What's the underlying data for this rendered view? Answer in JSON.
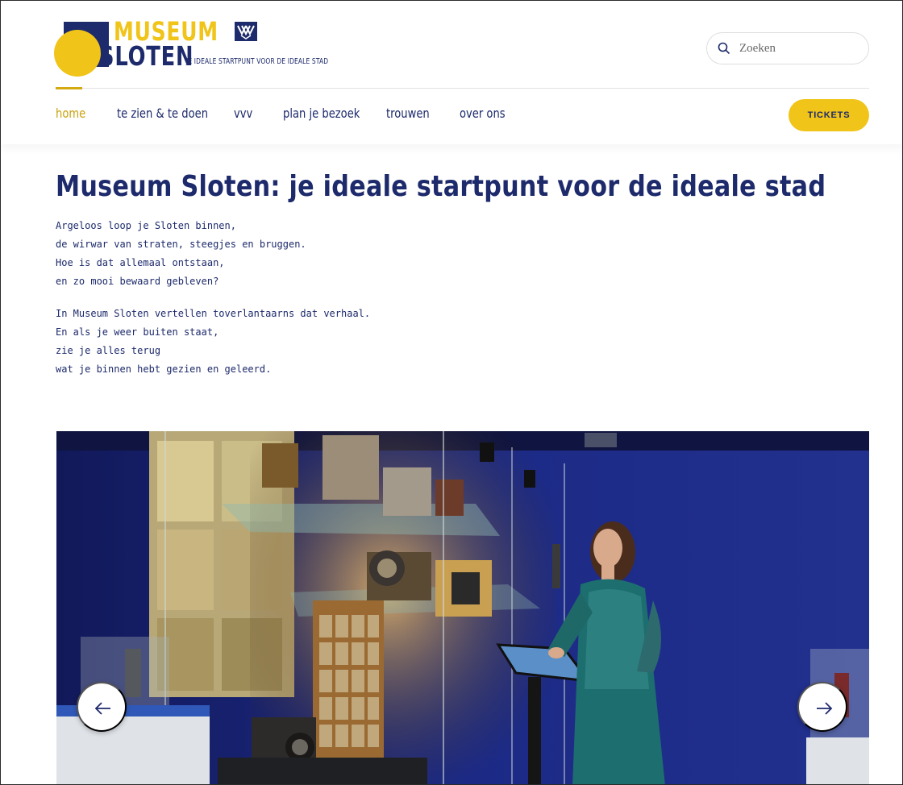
{
  "logo": {
    "word_top": "MUSEUM",
    "word_bottom": "SLOTEN",
    "tagline": "JE IDEALE STARTPUNT VOOR DE IDEALE STAD",
    "brand_colors": {
      "navy": "#1d2a6b",
      "yellow": "#f0c419"
    }
  },
  "search": {
    "placeholder": "Zoeken",
    "value": "",
    "icon": "search-icon"
  },
  "nav": {
    "items": [
      {
        "label": "home",
        "active": true
      },
      {
        "label": "te zien & te doen",
        "active": false
      },
      {
        "label": "vvv",
        "active": false
      },
      {
        "label": "plan je bezoek",
        "active": false
      },
      {
        "label": "trouwen",
        "active": false
      },
      {
        "label": "over ons",
        "active": false
      }
    ],
    "tickets_label": "TICKETS"
  },
  "main": {
    "title": "Museum Sloten: je ideale startpunt voor de ideale stad",
    "poem_stanza_1": "Argeloos loop je Sloten binnen,\nde wirwar van straten, steegjes en bruggen.\nHoe is dat allemaal ontstaan,\nen zo mooi bewaard gebleven?",
    "poem_stanza_2": "In Museum Sloten vertellen toverlantaarns dat verhaal.\nEn als je weer buiten staat,\nzie je alles terug\nwat je binnen hebt gezien en geleerd."
  },
  "slider": {
    "prev_icon": "arrow-left-icon",
    "next_icon": "arrow-right-icon"
  }
}
